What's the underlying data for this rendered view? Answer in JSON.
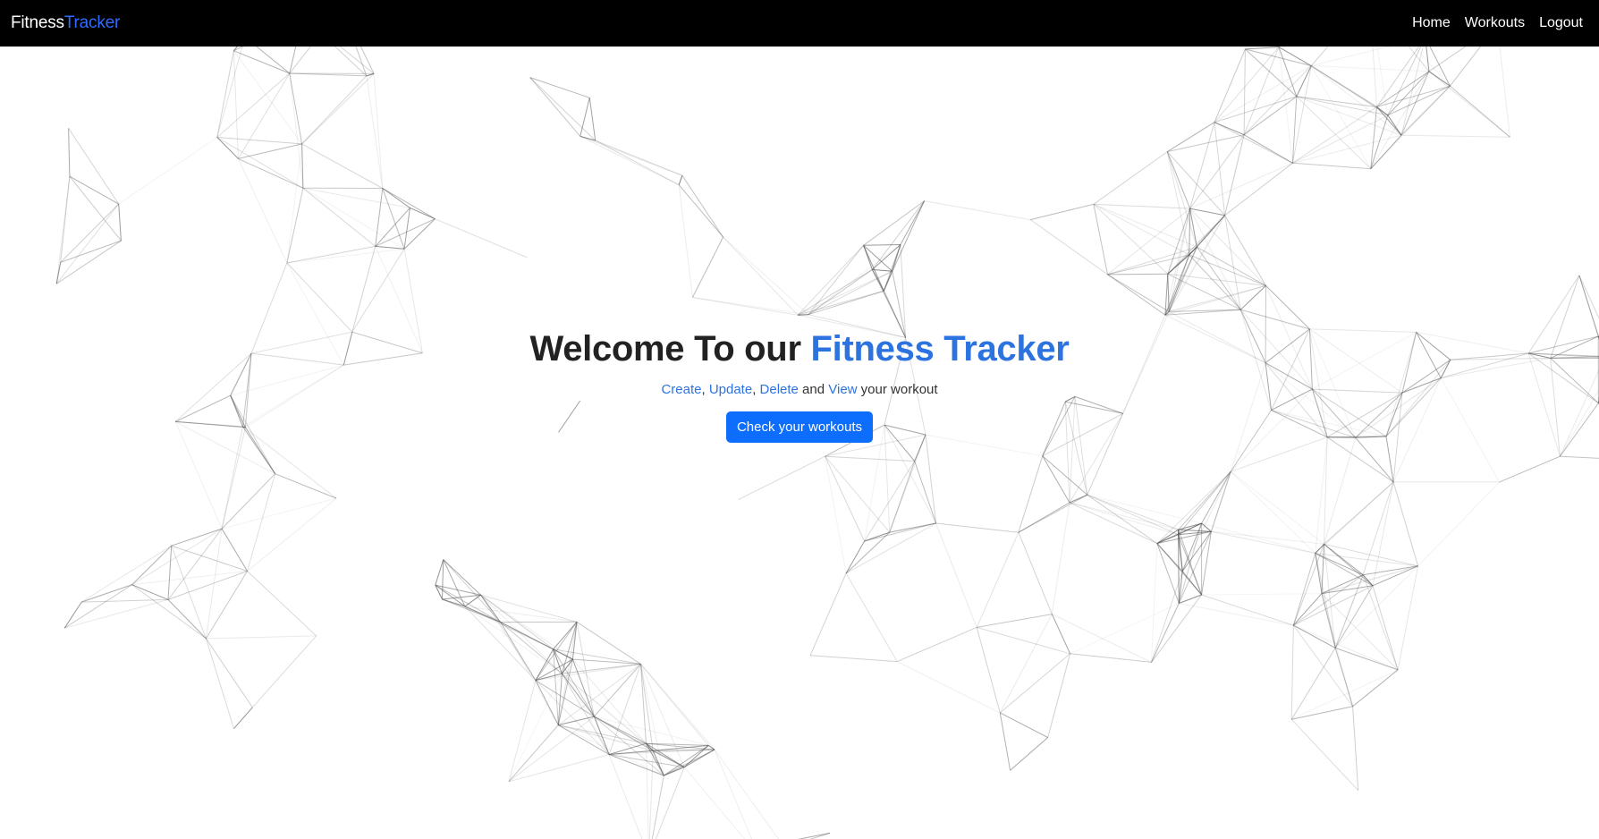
{
  "navbar": {
    "brand_primary": "Fitness",
    "brand_accent": "Tracker",
    "links": {
      "home": "Home",
      "workouts": "Workouts",
      "logout": "Logout"
    }
  },
  "hero": {
    "title_primary": "Welcome To our ",
    "title_accent": "Fitness Tracker",
    "subtitle": {
      "create": "Create",
      "sep1": ", ",
      "update": "Update",
      "sep2": ", ",
      "delete": "Delete",
      "and": " and ",
      "view": "View",
      "tail": " your workout"
    },
    "cta_label": "Check your workouts"
  },
  "colors": {
    "navbar_bg": "#000000",
    "brand_accent": "#2f6bff",
    "text_accent": "#2d73e0",
    "button_bg": "#0d6efd",
    "network_lines": "#555555"
  },
  "background": {
    "type": "particle-network"
  }
}
